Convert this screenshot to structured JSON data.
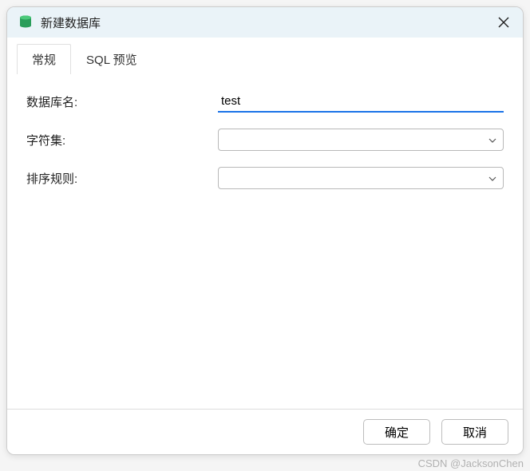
{
  "window": {
    "title": "新建数据库"
  },
  "tabs": [
    {
      "label": "常规",
      "active": true
    },
    {
      "label": "SQL 预览",
      "active": false
    }
  ],
  "form": {
    "dbname_label": "数据库名:",
    "dbname_value": "test",
    "charset_label": "字符集:",
    "charset_value": "",
    "collation_label": "排序规则:",
    "collation_value": ""
  },
  "footer": {
    "ok_label": "确定",
    "cancel_label": "取消"
  },
  "watermark": "CSDN @JacksonChen"
}
